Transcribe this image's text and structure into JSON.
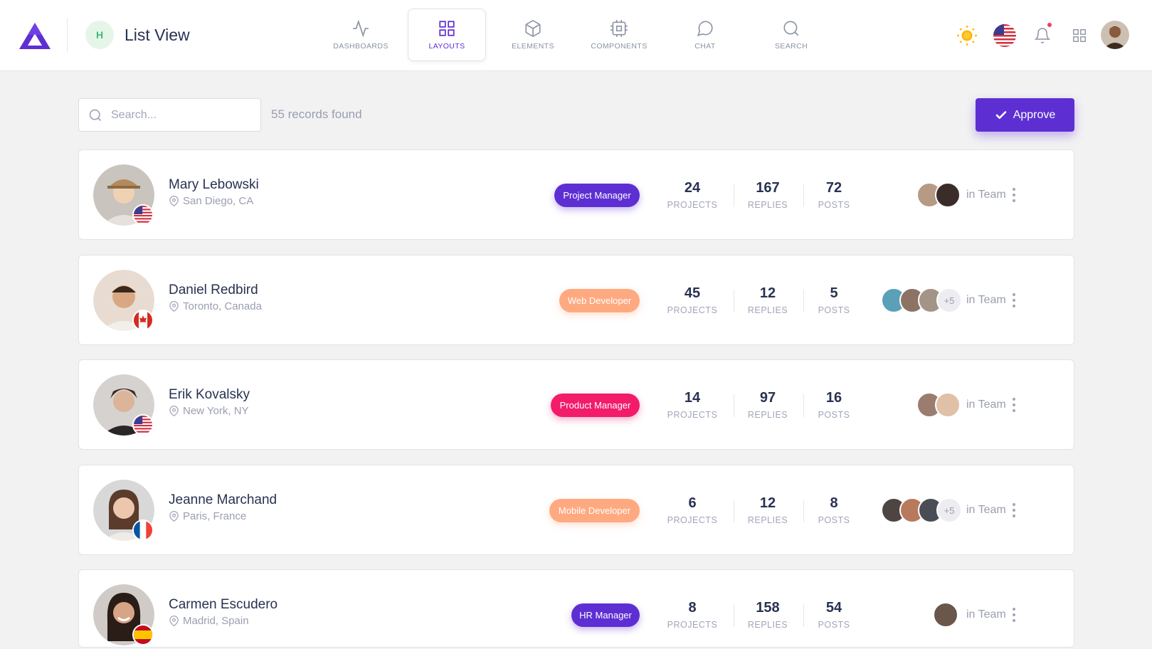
{
  "header": {
    "project_initial": "H",
    "title": "List View",
    "nav": [
      {
        "label": "DASHBOARDS",
        "icon": "activity-icon",
        "active": false
      },
      {
        "label": "LAYOUTS",
        "icon": "grid-icon",
        "active": true
      },
      {
        "label": "ELEMENTS",
        "icon": "box-icon",
        "active": false
      },
      {
        "label": "COMPONENTS",
        "icon": "cpu-icon",
        "active": false
      },
      {
        "label": "CHAT",
        "icon": "message-circle-icon",
        "active": false
      },
      {
        "label": "SEARCH",
        "icon": "search-icon",
        "active": false
      }
    ],
    "right_icons": [
      "sun-icon",
      "us-flag-icon",
      "bell-icon",
      "apps-grid-icon",
      "user-avatar"
    ]
  },
  "toolbar": {
    "search_placeholder": "Search...",
    "records_text": "55 records found",
    "approve_label": "Approve"
  },
  "colors": {
    "accent": "#5d2fd3",
    "web_developer": "#ffa981",
    "product_manager": "#f21c6a",
    "page_bg": "#f2f2f3"
  },
  "people": [
    {
      "name": "Mary Lebowski",
      "location": "San Diego, CA",
      "flag": "us",
      "role": "Project Manager",
      "role_color": "#5d2fd3",
      "projects": "24",
      "replies": "167",
      "posts": "72",
      "team_count": 2,
      "team_more": "",
      "team_label": "in Team"
    },
    {
      "name": "Daniel Redbird",
      "location": "Toronto, Canada",
      "flag": "ca",
      "role": "Web Developer",
      "role_color": "#ffa981",
      "projects": "45",
      "replies": "12",
      "posts": "5",
      "team_count": 3,
      "team_more": "+5",
      "team_label": "in Team"
    },
    {
      "name": "Erik Kovalsky",
      "location": "New York, NY",
      "flag": "us",
      "role": "Product Manager",
      "role_color": "#f21c6a",
      "projects": "14",
      "replies": "97",
      "posts": "16",
      "team_count": 2,
      "team_more": "",
      "team_label": "in Team"
    },
    {
      "name": "Jeanne Marchand",
      "location": "Paris, France",
      "flag": "fr",
      "role": "Mobile Developer",
      "role_color": "#ffa981",
      "projects": "6",
      "replies": "12",
      "posts": "8",
      "team_count": 3,
      "team_more": "+5",
      "team_label": "in Team"
    },
    {
      "name": "Carmen Escudero",
      "location": "Madrid, Spain",
      "flag": "es",
      "role": "HR Manager",
      "role_color": "#5d2fd3",
      "projects": "8",
      "replies": "158",
      "posts": "54",
      "team_count": 1,
      "team_more": "",
      "team_label": "in Team"
    }
  ],
  "stat_labels": {
    "projects": "PROJECTS",
    "replies": "REPLIES",
    "posts": "POSTS"
  }
}
